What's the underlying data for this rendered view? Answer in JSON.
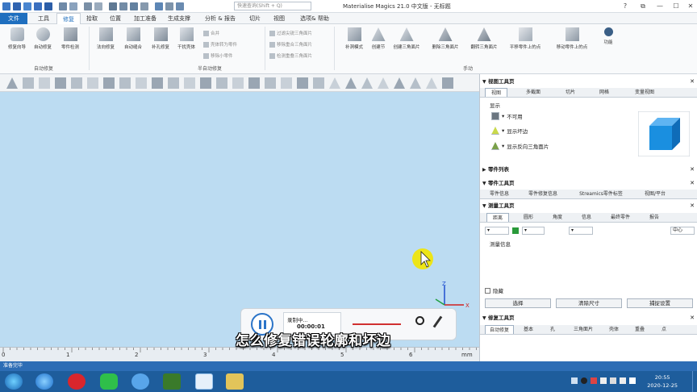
{
  "titlebar": {
    "search_placeholder": "快速查询(Shift + Q)",
    "app_title": "Materialise Magics 21.0 中文版 - 无标题",
    "win_help": "?",
    "win_restore": "⧉",
    "win_minimize": "—",
    "win_maximize": "☐",
    "win_close": "✕"
  },
  "menu": {
    "file": "文件",
    "tools": "工具",
    "repair": "修复",
    "sections": "拾取",
    "position": "位置",
    "build_prep": "加工准备",
    "generate_support": "生成支撑",
    "analysis": "分析 & 报告",
    "slice": "切片",
    "view": "视图",
    "options": "选项& 帮助"
  },
  "ribbon": {
    "auto_fix": [
      {
        "name": "repair-wizard",
        "label": "修复向导"
      },
      {
        "name": "auto-repair",
        "label": "自动修复"
      },
      {
        "name": "part-check",
        "label": "零件检测"
      }
    ],
    "semi_fix": [
      {
        "name": "unify-normals",
        "label": "法向修复"
      },
      {
        "name": "auto-stitch",
        "label": "自动缝合"
      },
      {
        "name": "fill-holes",
        "label": "补孔修复"
      },
      {
        "name": "shell-check",
        "label": "干扰壳体"
      }
    ],
    "small_items": [
      "合并",
      "壳体转为零件",
      "移除小零件"
    ],
    "triangle_items": [
      "过滤尖锐三角面片",
      "移除重合三角面片",
      "检测重叠三角面片"
    ],
    "manual": [
      {
        "name": "repair-mode",
        "label": "补洞模式"
      },
      {
        "name": "create-edge",
        "label": "创建节"
      },
      {
        "name": "create-triangle",
        "label": "创建三角面片"
      },
      {
        "name": "delete-triangle",
        "label": "删除三角面片"
      },
      {
        "name": "flip-triangle",
        "label": "翻转三角面片"
      },
      {
        "name": "move-point",
        "label": "平移零件上的点"
      },
      {
        "name": "move-point-2",
        "label": "移动零件上的点"
      },
      {
        "name": "more",
        "label": "功能"
      }
    ],
    "group_labels": {
      "auto": "自动修复",
      "semi": "半自动修复",
      "manual": "手动"
    }
  },
  "viewport": {
    "cursor_color": "#f2e600",
    "axis_x": "X",
    "axis_z": "Z"
  },
  "ruler": {
    "labels": [
      "0",
      "1",
      "2",
      "3",
      "4",
      "5",
      "6"
    ],
    "unit": "mm"
  },
  "status": {
    "text": "准备完毕"
  },
  "right_panel": {
    "view_tools_title": "视图工具页",
    "view_tabs": [
      "视图",
      "多截面",
      "切片",
      "网格",
      "变量视图"
    ],
    "display_label": "显示",
    "display_items": [
      "不可用",
      "显示坏边",
      "显示反向三角面片"
    ],
    "part_list_title": "零件列表",
    "part_tools_title": "零件工具页",
    "part_tabs": [
      "零件信息",
      "零件修复信息",
      "Streamics零件标签",
      "视图/平台"
    ],
    "measure_title": "测量工具页",
    "measure_tabs": [
      "距离",
      "圆形",
      "角度",
      "信息",
      "最终零件",
      "报告"
    ],
    "center_option": "中心",
    "measure_info": "测量信息",
    "hide_checkbox": "隐藏",
    "buttons": [
      "选择",
      "清除尺寸",
      "捕捉设置"
    ],
    "repair_tools_title": "修复工具页",
    "repair_tabs": [
      "自动修复",
      "基本",
      "孔",
      "三角面片",
      "壳体",
      "重叠",
      "点"
    ]
  },
  "recorder": {
    "status": "录制中...",
    "time": "00:00:01"
  },
  "subtitle": "怎么修复错误轮廓和坏边",
  "taskbar": {
    "time": "20:55",
    "date": "2020-12-25"
  },
  "colors": {
    "accent": "#1f6fbf",
    "viewport": "#bcdcf2",
    "status": "#2d6db5",
    "taskbar": "#1e5d9c",
    "cube": "#1a8fe0"
  }
}
